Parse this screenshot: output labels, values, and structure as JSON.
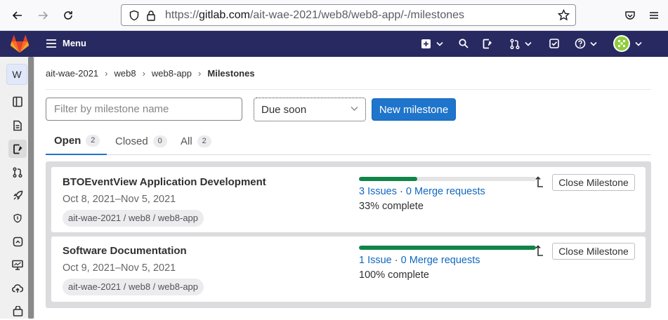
{
  "browser": {
    "url_prefix": "https://",
    "url_host": "gitlab.com",
    "url_path": "/ait-wae-2021/web8/web8-app/-/milestones"
  },
  "topnav": {
    "menu_label": "Menu"
  },
  "sidebar": {
    "project_initial": "W"
  },
  "breadcrumb": {
    "items": [
      "ait-wae-2021",
      "web8",
      "web8-app"
    ],
    "current": "Milestones"
  },
  "controls": {
    "filter_placeholder": "Filter by milestone name",
    "sort_value": "Due soon",
    "new_button": "New milestone"
  },
  "tabs": [
    {
      "label": "Open",
      "count": "2",
      "active": true
    },
    {
      "label": "Closed",
      "count": "0",
      "active": false
    },
    {
      "label": "All",
      "count": "2",
      "active": false
    }
  ],
  "milestones": [
    {
      "title": "BTOEventView Application Development",
      "dates": "Oct 8, 2021–Nov 5, 2021",
      "path": "ait-wae-2021 / web8 / web8-app",
      "progress": 0.33,
      "issues": "3 Issues",
      "separator": "·",
      "merge_requests": "0 Merge requests",
      "complete": "33% complete",
      "close_label": "Close Milestone"
    },
    {
      "title": "Software Documentation",
      "dates": "Oct 9, 2021–Nov 5, 2021",
      "path": "ait-wae-2021 / web8 / web8-app",
      "progress": 1.0,
      "issues": "1 Issue",
      "separator": "·",
      "merge_requests": "0 Merge requests",
      "complete": "100% complete",
      "close_label": "Close Milestone"
    }
  ],
  "colors": {
    "nav_bg": "#292961",
    "primary": "#1f75cb",
    "progress": "#108548",
    "link": "#1068bf"
  }
}
